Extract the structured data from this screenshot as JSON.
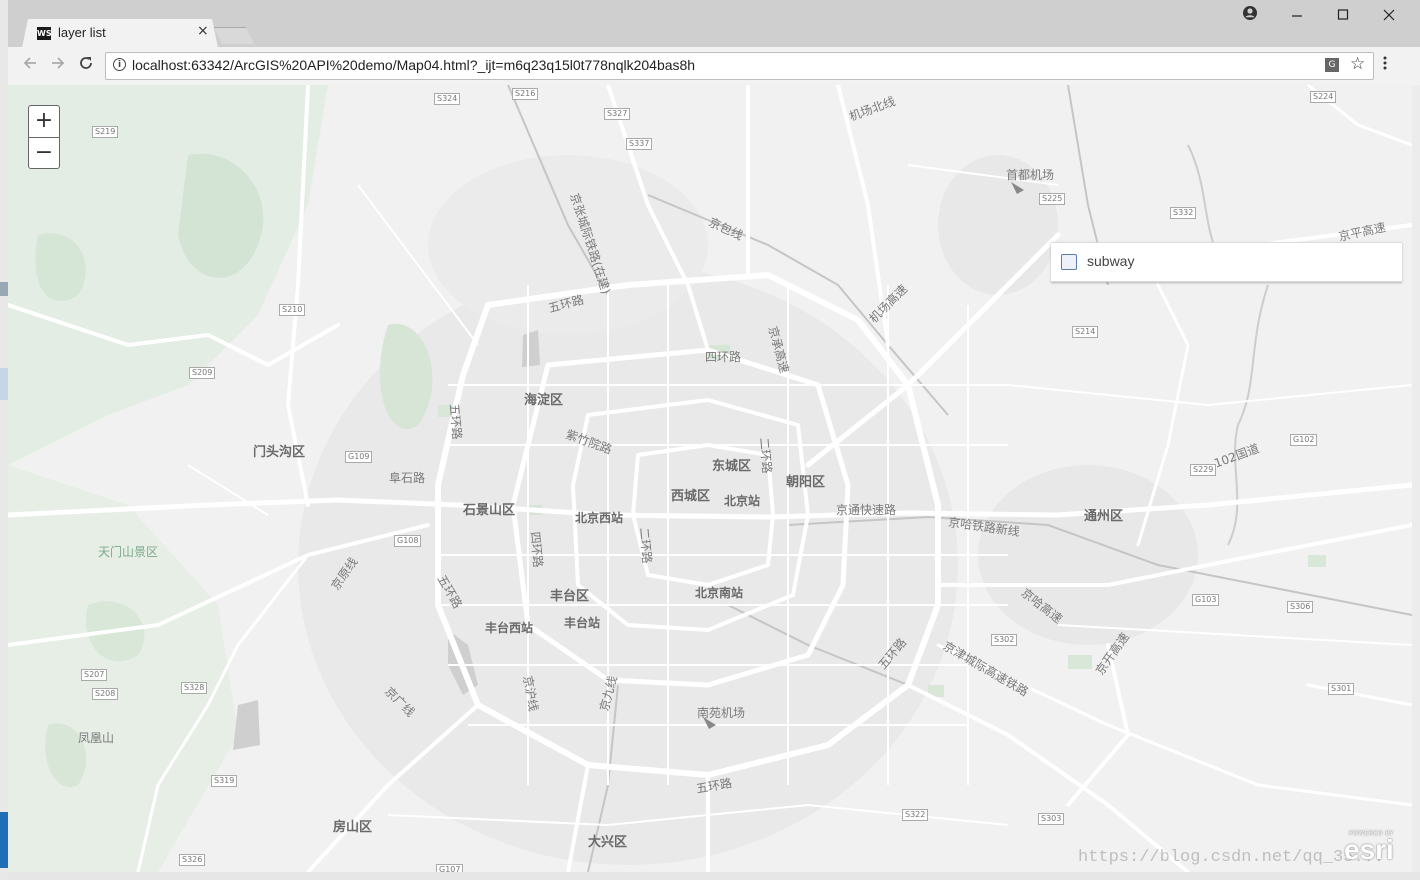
{
  "browser": {
    "tab_title": "layer list",
    "tab_icon": "WS",
    "tab_close": "×",
    "url": "localhost:63342/ArcGIS%20API%20demo/Map04.html?_ijt=m6q23q15l0t778nqlk204bas8h"
  },
  "map": {
    "zoom_in": "+",
    "zoom_out": "−",
    "layer_list": {
      "items": [
        {
          "label": "subway",
          "checked": false
        }
      ]
    },
    "district_labels": [
      "海淀区",
      "东城区",
      "西城区",
      "朝阳区",
      "丰台区",
      "石景山区",
      "门头沟区",
      "通州区",
      "房山区",
      "大兴区"
    ],
    "place_labels": [
      "北京站",
      "北京西站",
      "北京南站",
      "丰台站",
      "丰台西站",
      "首都机场",
      "南苑机场",
      "凤凰山"
    ],
    "green_labels": [
      "天门山景区"
    ],
    "road_labels": [
      "五环路",
      "四环路",
      "紫竹院路",
      "阜石路",
      "京包线",
      "京张城际铁路(在建)",
      "机场北线",
      "机场高速",
      "京承高速",
      "京通快速路",
      "京哈铁路新线",
      "京哈高速",
      "京津城际高速铁路",
      "京广线",
      "京沪线",
      "京原线",
      "京九线",
      "京开高速",
      "京平高速",
      "102国道",
      "二环路",
      "五环路 ",
      "五环路  ",
      "五环路   ",
      "五环路    ",
      "四环路 ",
      "二环路 "
    ],
    "road_shields": [
      "S324",
      "S216",
      "S327",
      "S337",
      "S219",
      "S210",
      "S209",
      "G109",
      "G108",
      "S207",
      "S208",
      "S328",
      "S319",
      "S326",
      "G107",
      "S224",
      "S225",
      "S332",
      "S214",
      "G102",
      "S229",
      "G103",
      "S306",
      "S302",
      "S301",
      "S322",
      "S303"
    ],
    "attribution_small": "POWERED BY",
    "attribution": "esri",
    "watermark": "https://blog.csdn.net/qq_35..."
  },
  "colors": {
    "map_background": "#f1f1f1",
    "road": "#ffffff",
    "green": "#d6e6d6",
    "urban": "#e6e6e6",
    "water": "#c9c9c9"
  }
}
